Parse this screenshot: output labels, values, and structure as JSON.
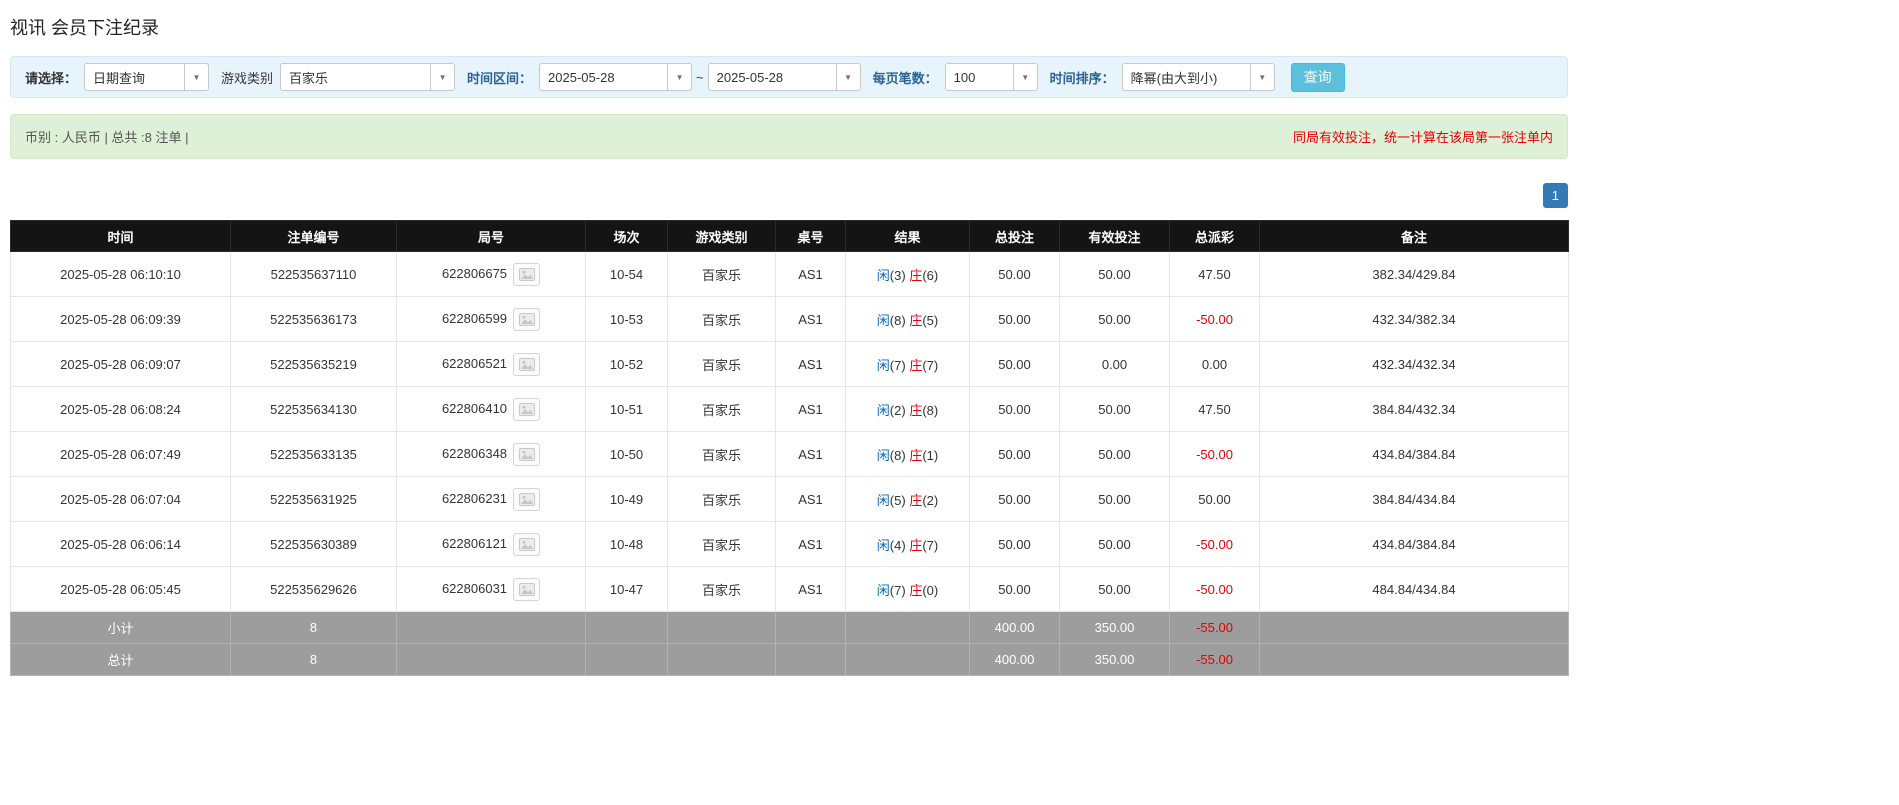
{
  "page": {
    "title": "视讯 会员下注纪录"
  },
  "filters": {
    "select_label": "请选择：",
    "select_value": "日期查询",
    "game_type_label": "游戏类别",
    "game_type_value": "百家乐",
    "time_range_label": "时间区间：",
    "date_from": "2025-05-28",
    "tilde": "~",
    "date_to": "2025-05-28",
    "page_size_label": "每页笔数：",
    "page_size_value": "100",
    "sort_label": "时间排序：",
    "sort_value": "降幂(由大到小)",
    "search_button": "查询"
  },
  "summary": {
    "left": "币别 : 人民币 | 总共 :8 注单 |",
    "right": "同局有效投注，统一计算在该局第一张注单内"
  },
  "pagination": {
    "current": "1"
  },
  "table": {
    "headers": [
      "时间",
      "注单编号",
      "局号",
      "场次",
      "游戏类别",
      "桌号",
      "结果",
      "总投注",
      "有效投注",
      "总派彩",
      "备注"
    ],
    "rows": [
      {
        "time": "2025-05-28 06:10:10",
        "bet_id": "522535637110",
        "round_id": "622806675",
        "session": "10-54",
        "game": "百家乐",
        "table_no": "AS1",
        "res_p": "闲",
        "res_p_n": "(3)",
        "res_b": "庄",
        "res_b_n": "(6)",
        "total_bet": "50.00",
        "valid_bet": "50.00",
        "payout": "47.50",
        "remark": "382.34/429.84"
      },
      {
        "time": "2025-05-28 06:09:39",
        "bet_id": "522535636173",
        "round_id": "622806599",
        "session": "10-53",
        "game": "百家乐",
        "table_no": "AS1",
        "res_p": "闲",
        "res_p_n": "(8)",
        "res_b": "庄",
        "res_b_n": "(5)",
        "total_bet": "50.00",
        "valid_bet": "50.00",
        "payout": "-50.00",
        "remark": "432.34/382.34"
      },
      {
        "time": "2025-05-28 06:09:07",
        "bet_id": "522535635219",
        "round_id": "622806521",
        "session": "10-52",
        "game": "百家乐",
        "table_no": "AS1",
        "res_p": "闲",
        "res_p_n": "(7)",
        "res_b": "庄",
        "res_b_n": "(7)",
        "total_bet": "50.00",
        "valid_bet": "0.00",
        "payout": "0.00",
        "remark": "432.34/432.34"
      },
      {
        "time": "2025-05-28 06:08:24",
        "bet_id": "522535634130",
        "round_id": "622806410",
        "session": "10-51",
        "game": "百家乐",
        "table_no": "AS1",
        "res_p": "闲",
        "res_p_n": "(2)",
        "res_b": "庄",
        "res_b_n": "(8)",
        "total_bet": "50.00",
        "valid_bet": "50.00",
        "payout": "47.50",
        "remark": "384.84/432.34"
      },
      {
        "time": "2025-05-28 06:07:49",
        "bet_id": "522535633135",
        "round_id": "622806348",
        "session": "10-50",
        "game": "百家乐",
        "table_no": "AS1",
        "res_p": "闲",
        "res_p_n": "(8)",
        "res_b": "庄",
        "res_b_n": "(1)",
        "total_bet": "50.00",
        "valid_bet": "50.00",
        "payout": "-50.00",
        "remark": "434.84/384.84"
      },
      {
        "time": "2025-05-28 06:07:04",
        "bet_id": "522535631925",
        "round_id": "622806231",
        "session": "10-49",
        "game": "百家乐",
        "table_no": "AS1",
        "res_p": "闲",
        "res_p_n": "(5)",
        "res_b": "庄",
        "res_b_n": "(2)",
        "total_bet": "50.00",
        "valid_bet": "50.00",
        "payout": "50.00",
        "remark": "384.84/434.84"
      },
      {
        "time": "2025-05-28 06:06:14",
        "bet_id": "522535630389",
        "round_id": "622806121",
        "session": "10-48",
        "game": "百家乐",
        "table_no": "AS1",
        "res_p": "闲",
        "res_p_n": "(4)",
        "res_b": "庄",
        "res_b_n": "(7)",
        "total_bet": "50.00",
        "valid_bet": "50.00",
        "payout": "-50.00",
        "remark": "434.84/384.84"
      },
      {
        "time": "2025-05-28 06:05:45",
        "bet_id": "522535629626",
        "round_id": "622806031",
        "session": "10-47",
        "game": "百家乐",
        "table_no": "AS1",
        "res_p": "闲",
        "res_p_n": "(7)",
        "res_b": "庄",
        "res_b_n": "(0)",
        "total_bet": "50.00",
        "valid_bet": "50.00",
        "payout": "-50.00",
        "remark": "484.84/434.84"
      }
    ],
    "footer": [
      {
        "label": "小计",
        "count": "8",
        "total_bet": "400.00",
        "valid_bet": "350.00",
        "payout": "-55.00"
      },
      {
        "label": "总计",
        "count": "8",
        "total_bet": "400.00",
        "valid_bet": "350.00",
        "payout": "-55.00"
      }
    ]
  }
}
